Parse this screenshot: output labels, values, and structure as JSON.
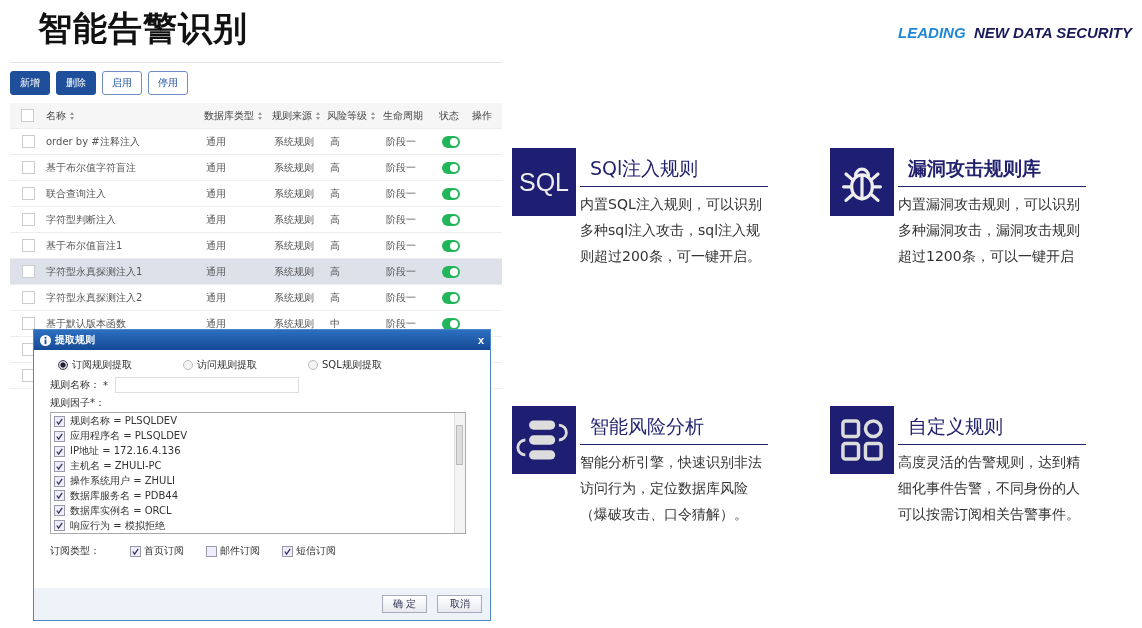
{
  "header": {
    "title": "智能告警识别",
    "tagline_lead": "LEADING",
    "tagline_rest": "NEW DATA SECURITY"
  },
  "toolbar": [
    {
      "label": "新增",
      "kind": "primary"
    },
    {
      "label": "删除",
      "kind": "primary"
    },
    {
      "label": "启用",
      "kind": "outline"
    },
    {
      "label": "停用",
      "kind": "outline"
    }
  ],
  "table": {
    "header_checked": false,
    "columns": [
      {
        "label": "名称",
        "sortable": true
      },
      {
        "label": "数据库类型",
        "sortable": true
      },
      {
        "label": "规则来源",
        "sortable": true
      },
      {
        "label": "风险等级",
        "sortable": true
      },
      {
        "label": "生命周期",
        "sortable": false
      },
      {
        "label": "状态",
        "sortable": false
      },
      {
        "label": "操作",
        "sortable": false
      }
    ],
    "rows": [
      {
        "checked": false,
        "selected": false,
        "cells": [
          "order by #注释注入",
          "通用",
          "系统规则",
          "高",
          "阶段一"
        ],
        "on": true
      },
      {
        "checked": false,
        "selected": false,
        "cells": [
          "基于布尔值字符盲注",
          "通用",
          "系统规则",
          "高",
          "阶段一"
        ],
        "on": true
      },
      {
        "checked": false,
        "selected": false,
        "cells": [
          "联合查询注入",
          "通用",
          "系统规则",
          "高",
          "阶段一"
        ],
        "on": true
      },
      {
        "checked": false,
        "selected": false,
        "cells": [
          "字符型判断注入",
          "通用",
          "系统规则",
          "高",
          "阶段一"
        ],
        "on": true
      },
      {
        "checked": false,
        "selected": false,
        "cells": [
          "基于布尔值盲注1",
          "通用",
          "系统规则",
          "高",
          "阶段一"
        ],
        "on": true
      },
      {
        "checked": false,
        "selected": true,
        "cells": [
          "字符型永真探测注入1",
          "通用",
          "系统规则",
          "高",
          "阶段一"
        ],
        "on": true
      },
      {
        "checked": false,
        "selected": false,
        "cells": [
          "字符型永真探测注入2",
          "通用",
          "系统规则",
          "高",
          "阶段一"
        ],
        "on": true
      },
      {
        "checked": false,
        "selected": false,
        "cells": [
          "基于默认版本函数",
          "通用",
          "系统规则",
          "中",
          "阶段一"
        ],
        "on": true
      },
      {
        "checked": false,
        "selected": false
      },
      {
        "checked": false,
        "selected": false
      }
    ]
  },
  "dialog": {
    "title": "提取规则",
    "close": "x",
    "modes": [
      {
        "label": "订阅规则提取",
        "selected": true
      },
      {
        "label": "访问规则提取",
        "selected": false
      },
      {
        "label": "SQL规则提取",
        "selected": false
      }
    ],
    "name_label": "规则名称：",
    "required_mark": "*",
    "factors_label": "规则因子*：",
    "factors": [
      {
        "label": "规则名称 = PLSQLDEV",
        "checked": true
      },
      {
        "label": "应用程序名 = PLSQLDEV",
        "checked": true
      },
      {
        "label": "IP地址 = 172.16.4.136",
        "checked": true
      },
      {
        "label": "主机名 = ZHULI-PC",
        "checked": true
      },
      {
        "label": "操作系统用户 = ZHULI",
        "checked": true
      },
      {
        "label": "数据库服务名 = PDB44",
        "checked": true
      },
      {
        "label": "数据库实例名 = ORCL",
        "checked": true
      },
      {
        "label": "响应行为 = 模拟拒绝",
        "checked": true
      }
    ],
    "subscription_label": "订阅类型：",
    "subscriptions": [
      {
        "label": "首页订阅",
        "checked": true
      },
      {
        "label": "邮件订阅",
        "checked": false
      },
      {
        "label": "短信订阅",
        "checked": true
      }
    ],
    "buttons": [
      "确 定",
      "取消"
    ]
  },
  "features": [
    {
      "kind": "sql",
      "icon_text": "SQL",
      "title": "SQl注入规则",
      "bold": false,
      "text": "内置SQL注入规则，可以识别多种sql注入攻击，sql注入规则超过200条，可一键开启。"
    },
    {
      "kind": "bug",
      "title": "漏洞攻击规则库",
      "bold": true,
      "text": "内置漏洞攻击规则，可以识别多种漏洞攻击，漏洞攻击规则超过1200条，可以一键开启"
    },
    {
      "kind": "pills",
      "title": "智能风险分析",
      "bold": false,
      "text": "智能分析引擎，快速识别非法访问行为，定位数据库风险（爆破攻击、口令猜解）。"
    },
    {
      "kind": "grid",
      "title": "自定义规则",
      "bold": false,
      "text": "高度灵活的告警规则，达到精细化事件告警，不同身份的人可以按需订阅相关告警事件。"
    }
  ]
}
